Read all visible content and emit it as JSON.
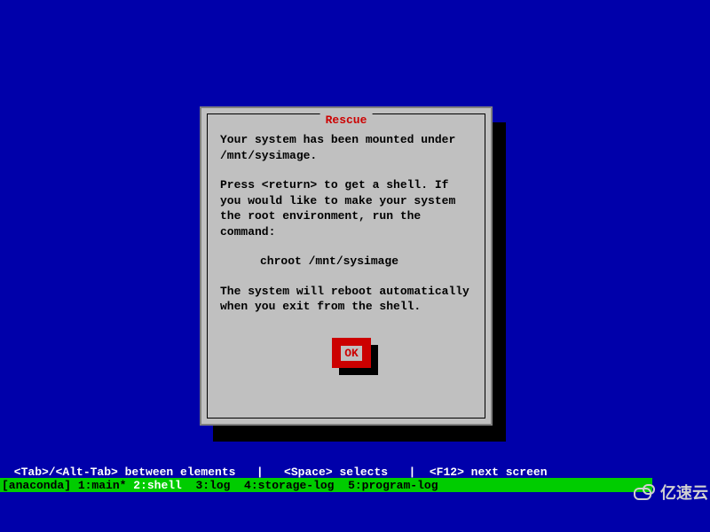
{
  "dialog": {
    "title": "Rescue",
    "para1": "Your system has been mounted under /mnt/sysimage.",
    "para2": "Press <return> to get a shell. If you would like to make your system the root environment, run the command:",
    "command": "chroot /mnt/sysimage",
    "para3": "The system will reboot automatically when you exit from the shell.",
    "ok_label": "OK"
  },
  "help_bar": " <Tab>/<Alt-Tab> between elements   |   <Space> selects   |  <F12> next screen",
  "status_bar": {
    "prefix": "[anaconda] 1:main* ",
    "active": "2:shell",
    "suffix": "  3:log  4:storage-log  5:program-log"
  },
  "watermark": {
    "text": "亿速云"
  }
}
